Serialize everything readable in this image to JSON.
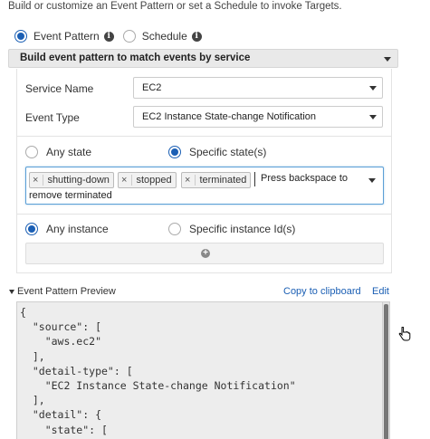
{
  "intro": "Build or customize an Event Pattern or set a Schedule to invoke Targets.",
  "mode": {
    "event_pattern_label": "Event Pattern",
    "schedule_label": "Schedule",
    "selected": "Event Pattern"
  },
  "section_header": "Build event pattern to match events by service",
  "service_name": {
    "label": "Service Name",
    "value": "EC2"
  },
  "event_type": {
    "label": "Event Type",
    "value": "EC2 Instance State-change Notification"
  },
  "state": {
    "any_label": "Any state",
    "specific_label": "Specific state(s)",
    "selected": "Specific state(s)"
  },
  "tokens": {
    "items": [
      "shutting-down",
      "stopped",
      "terminated"
    ],
    "remove_glyph": "×",
    "hint_line1": "Press backspace to",
    "hint_line2": "remove terminated"
  },
  "instance": {
    "any_label": "Any instance",
    "specific_label": "Specific instance Id(s)",
    "selected": "Any instance"
  },
  "preview": {
    "title": "Event Pattern Preview",
    "copy_label": "Copy to clipboard",
    "edit_label": "Edit",
    "code": "{\n  \"source\": [\n    \"aws.ec2\"\n  ],\n  \"detail-type\": [\n    \"EC2 Instance State-change Notification\"\n  ],\n  \"detail\": {\n    \"state\": [\n      \"shutting-down\""
  },
  "colors": {
    "accent": "#1b5fb4",
    "focus_border": "#5b9fd6",
    "header_bg": "#e9e9e9",
    "code_bg": "#ededed"
  }
}
